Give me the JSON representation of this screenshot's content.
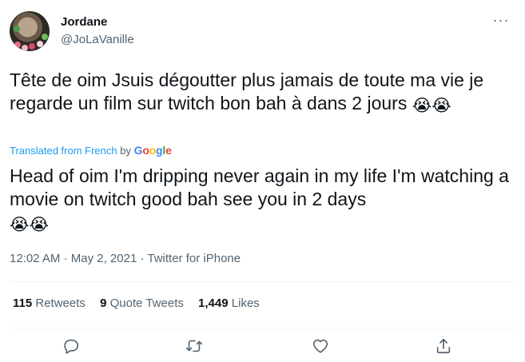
{
  "user": {
    "display_name": "Jordane",
    "handle": "@JoLaVanille"
  },
  "more_label": "···",
  "tweet": {
    "original_text": "Tête de oim Jsuis dégoutter plus jamais de toute ma vie je regarde un film sur twitch bon bah à dans 2 jours",
    "original_emojis": "😭😭",
    "translated_label": "Translated from French",
    "translated_by": "by",
    "google": [
      "G",
      "o",
      "o",
      "g",
      "l",
      "e"
    ],
    "translated_text": "Head of oim I'm dripping never again in my life I'm watching a movie on twitch good bah see you in 2 days",
    "translated_emojis": "😭😭"
  },
  "meta": {
    "time": "12:02 AM",
    "separator1": "·",
    "date": "May 2, 2021",
    "separator2": "·",
    "source": "Twitter for iPhone"
  },
  "stats": {
    "retweets_count": "115",
    "retweets_label": "Retweets",
    "quotes_count": "9",
    "quotes_label": "Quote Tweets",
    "likes_count": "1,449",
    "likes_label": "Likes"
  },
  "icons": [
    "reply-icon",
    "retweet-icon",
    "like-icon",
    "share-icon"
  ],
  "colors": {
    "link": "#1d9bf0",
    "secondary_text": "#536471",
    "primary_text": "#0f1419"
  }
}
